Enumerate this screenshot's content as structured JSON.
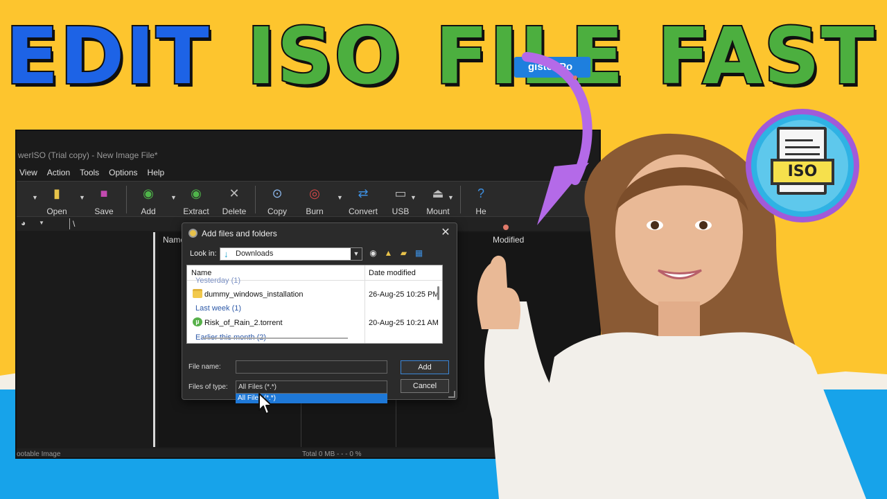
{
  "headline": {
    "word1": "EDIT",
    "word2": "ISO",
    "word3": "FILE",
    "word4": "FAST"
  },
  "app": {
    "title": "werISO (Trial copy) - New Image File*",
    "menu": [
      "View",
      "Action",
      "Tools",
      "Options",
      "Help"
    ],
    "toolbar": {
      "open": "Open",
      "save": "Save",
      "add": "Add",
      "extract": "Extract",
      "delete": "Delete",
      "copy": "Copy",
      "burn": "Burn",
      "convert": "Convert",
      "usb": "USB",
      "mount": "Mount",
      "help": "He"
    },
    "register_label": "gister Po",
    "address": "\\",
    "columns": {
      "name": "Name",
      "modified": "Modified"
    },
    "status_left": "ootable Image",
    "status_total": "Total  0 MB  - - -  0 %"
  },
  "dialog": {
    "title": "Add files and folders",
    "look_in_label": "Look in:",
    "look_in_value": "Downloads",
    "list_header": {
      "name": "Name",
      "date": "Date modified"
    },
    "groups": {
      "yesterday": "Yesterday (1)",
      "last_week": "Last week (1)",
      "earlier": "Earlier this month (2)"
    },
    "files": [
      {
        "name": "dummy_windows_installation",
        "date": "26-Aug-25 10:25 PM",
        "icon": "folder-icon"
      },
      {
        "name": "Risk_of_Rain_2.torrent",
        "date": "20-Aug-25 10:21 AM",
        "icon": "torrent-icon"
      }
    ],
    "file_name_label": "File name:",
    "file_name_value": "",
    "file_type_label": "Files of type:",
    "file_type_value": "All Files (*.*)",
    "file_type_option": "All Files (*.*)",
    "add_button": "Add",
    "cancel_button": "Cancel"
  },
  "badge": {
    "label": "ISO"
  },
  "colors": {
    "edit_blue": "#1d63e6",
    "headline_green": "#4caf3f",
    "background_yellow": "#fdc52e",
    "background_blue": "#17a3ea",
    "arrow_purple": "#b46ae8",
    "selection_blue": "#1e78d7"
  }
}
